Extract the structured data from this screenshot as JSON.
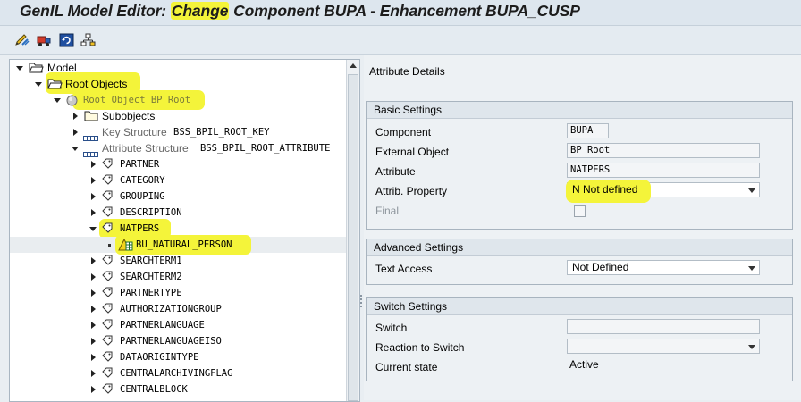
{
  "window": {
    "title_prefix": "GenIL Model Editor: ",
    "title_highlight": "Change",
    "title_rest": " Component BUPA - Enhancement BUPA_CUSP"
  },
  "toolbar": {
    "icons": [
      "display-change-icon",
      "transport-icon",
      "refresh-icon",
      "hierarchy-icon"
    ]
  },
  "tree": {
    "model": "Model",
    "root_objects": "Root Objects",
    "root_object": "Root Object BP_Root",
    "subobjects": "Subobjects",
    "key_structure_prefix": "Key Structure",
    "key_structure_name": "BSS_BPIL_ROOT_KEY",
    "attr_structure_prefix": "Attribute Structure",
    "attr_structure_name": "BSS_BPIL_ROOT_ATTRIBUTE",
    "attributes_before": [
      "PARTNER",
      "CATEGORY",
      "GROUPING",
      "DESCRIPTION"
    ],
    "natpers": "NATPERS",
    "natpers_child": "BU_NATURAL_PERSON",
    "attributes_after": [
      "SEARCHTERM1",
      "SEARCHTERM2",
      "PARTNERTYPE",
      "AUTHORIZATIONGROUP",
      "PARTNERLANGUAGE",
      "PARTNERLANGUAGEISO",
      "DATAORIGINTYPE",
      "CENTRALARCHIVINGFLAG",
      "CENTRALBLOCK"
    ]
  },
  "details": {
    "title": "Attribute Details",
    "basic": {
      "header": "Basic Settings",
      "component_label": "Component",
      "component_value": "BUPA",
      "external_object_label": "External Object",
      "external_object_value": "BP_Root",
      "attribute_label": "Attribute",
      "attribute_value": "NATPERS",
      "attrib_property_label": "Attrib. Property",
      "attrib_property_value": "N Not defined",
      "final_label": "Final"
    },
    "advanced": {
      "header": "Advanced Settings",
      "text_access_label": "Text Access",
      "text_access_value": "Not Defined"
    },
    "switch": {
      "header": "Switch Settings",
      "switch_label": "Switch",
      "switch_value": "",
      "reaction_label": "Reaction to Switch",
      "reaction_value": "",
      "current_state_label": "Current state",
      "current_state_value": "Active"
    }
  },
  "colors": {
    "highlight": "#f4f43a",
    "panel_bg": "#edf1f4",
    "group_border": "#a8b4bf"
  }
}
